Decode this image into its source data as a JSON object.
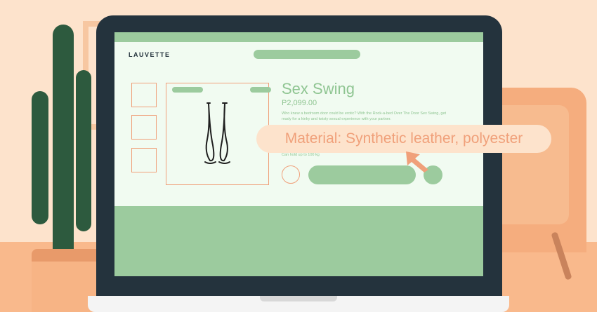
{
  "logo": {
    "text": "LAUVETTE"
  },
  "product": {
    "title": "Sex Swing",
    "price": "P2,099.00",
    "description": "Who knew a bedroom door could be erotic? With the Rock-a-bed Over The Door Sex Swing, get ready for a kinky and twisty sexual experience with your partner.",
    "note": "Can hold up to 100 kg"
  },
  "tooltip": {
    "text": "Material: Synthetic leather, polyester"
  },
  "icons": {
    "product": "swing-straps-icon",
    "pointer": "arrow-up-left-icon"
  },
  "colors": {
    "accent_green": "#9ccb9e",
    "accent_orange": "#f0a07a",
    "device": "#24333d",
    "background": "#fde3cc"
  }
}
